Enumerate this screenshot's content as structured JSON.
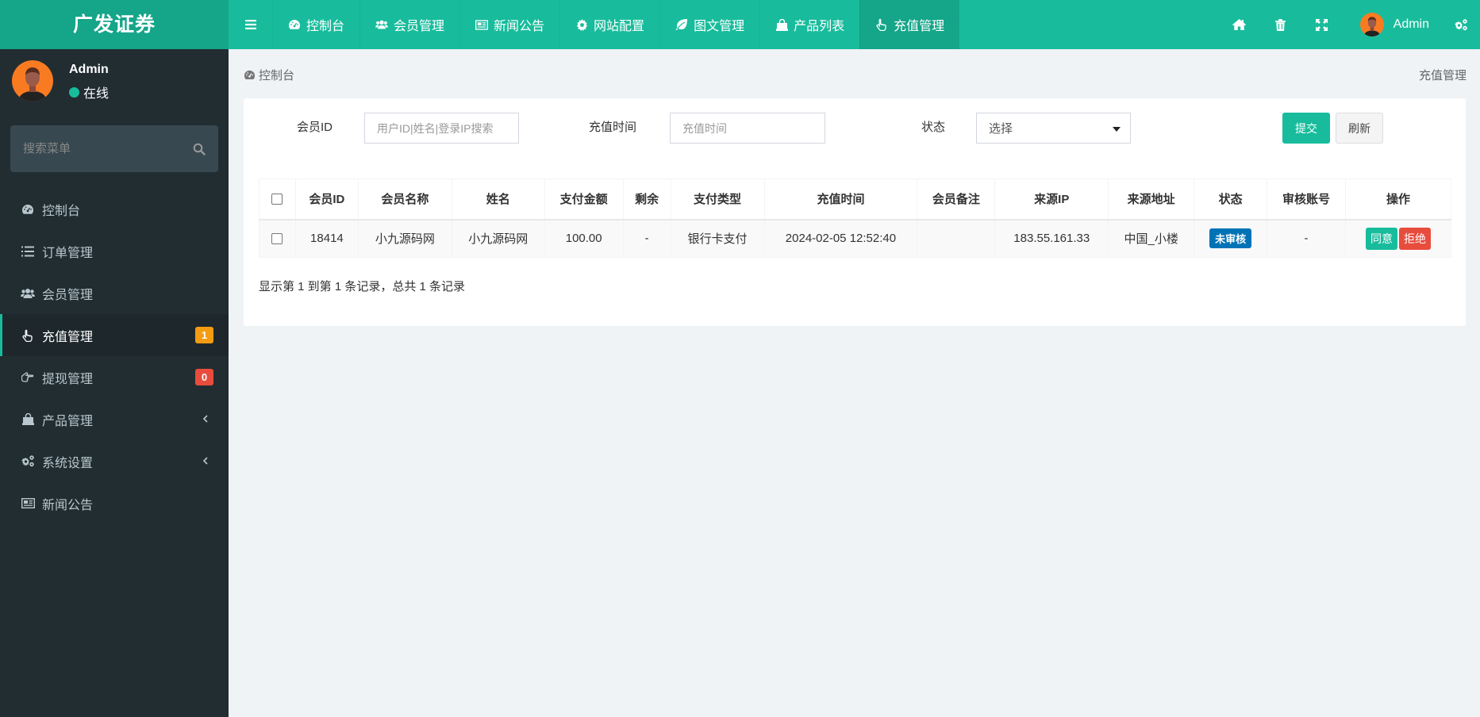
{
  "header": {
    "logo": "广发证券",
    "nav": [
      {
        "label": "控制台",
        "icon": "dashboard-icon"
      },
      {
        "label": "会员管理",
        "icon": "users-icon"
      },
      {
        "label": "新闻公告",
        "icon": "newspaper-icon"
      },
      {
        "label": "网站配置",
        "icon": "gear-icon"
      },
      {
        "label": "图文管理",
        "icon": "leaf-icon"
      },
      {
        "label": "产品列表",
        "icon": "shopping-bag-icon"
      },
      {
        "label": "充值管理",
        "icon": "hand-pointer-icon",
        "active": true
      }
    ],
    "right_icons": [
      "home-icon",
      "trash-icon",
      "fullscreen-icon",
      "settings-icon"
    ],
    "user_name": "Admin"
  },
  "sidebar": {
    "user": {
      "name": "Admin",
      "status": "在线"
    },
    "search_placeholder": "搜索菜单",
    "items": [
      {
        "label": "控制台",
        "icon": "dashboard-icon"
      },
      {
        "label": "订单管理",
        "icon": "list-icon"
      },
      {
        "label": "会员管理",
        "icon": "users-icon"
      },
      {
        "label": "充值管理",
        "icon": "hand-pointer-icon",
        "active": true,
        "badge": "1",
        "badge_color": "#f39c12"
      },
      {
        "label": "提现管理",
        "icon": "hand-left-icon",
        "badge": "0",
        "badge_color": "#e74c3c"
      },
      {
        "label": "产品管理",
        "icon": "shopping-bag-icon",
        "has_submenu": true
      },
      {
        "label": "系统设置",
        "icon": "cogs-icon",
        "has_submenu": true
      },
      {
        "label": "新闻公告",
        "icon": "newspaper-icon"
      }
    ]
  },
  "breadcrumb": {
    "left": "控制台",
    "right": "充值管理"
  },
  "filters": {
    "member_id_label": "会员ID",
    "member_id_placeholder": "用户ID|姓名|登录IP搜索",
    "member_id_value": "",
    "time_label": "充值时间",
    "time_placeholder": "充值时间",
    "time_value": "",
    "status_label": "状态",
    "status_selected": "选择",
    "submit_label": "提交",
    "refresh_label": "刷新"
  },
  "table": {
    "columns": [
      "会员ID",
      "会员名称",
      "姓名",
      "支付金额",
      "剩余",
      "支付类型",
      "充值时间",
      "会员备注",
      "来源IP",
      "来源地址",
      "状态",
      "审核账号",
      "操作"
    ],
    "rows": [
      {
        "member_id": "18414",
        "member_name": "小九源码网",
        "real_name": "小九源码网",
        "amount": "100.00",
        "remaining": "-",
        "pay_type": "银行卡支付",
        "time": "2024-02-05 12:52:40",
        "remark": "",
        "ip": "183.55.161.33",
        "location": "中国_小楼",
        "status": "未审核",
        "reviewer": "-",
        "approve_label": "同意",
        "reject_label": "拒绝"
      }
    ]
  },
  "summary": "显示第 1 到第 1 条记录，总共 1 条记录",
  "colors": {
    "primary": "#18bc9c",
    "primary_dark": "#15a589",
    "sidebar_bg": "#222d32",
    "danger": "#e74c3c",
    "warning": "#f39c12",
    "info": "#0073b7"
  }
}
